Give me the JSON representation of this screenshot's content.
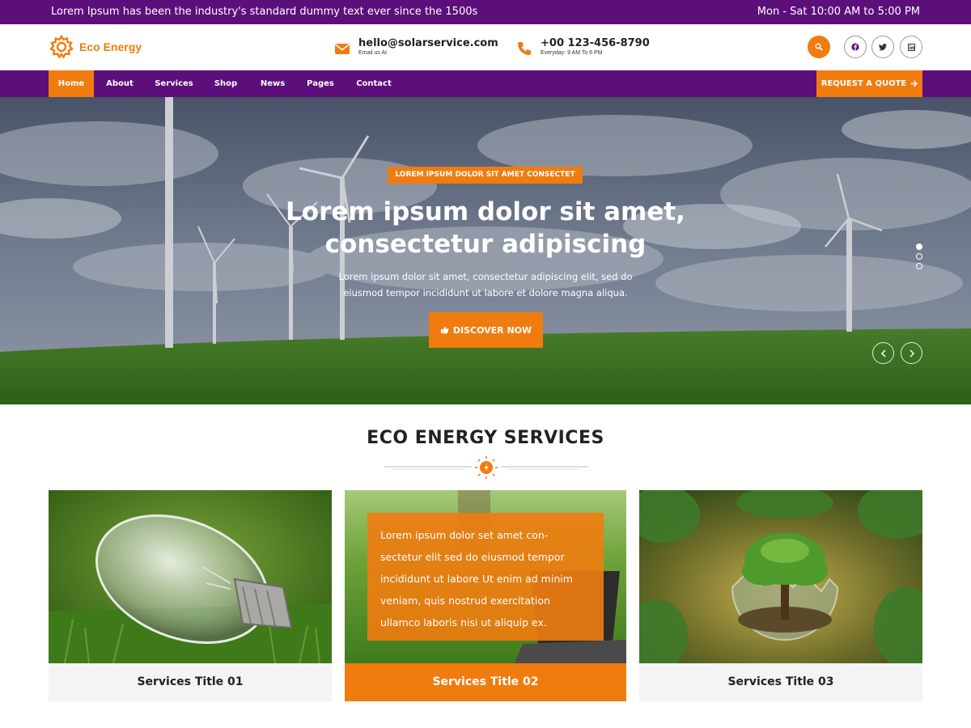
{
  "topbar": {
    "announcement": "Lorem Ipsum has been the industry's standard dummy text ever since the 1500s",
    "hours": "Mon - Sat 10:00 AM to 5:00 PM"
  },
  "header": {
    "logo_text": "Eco Energy",
    "email": "hello@solarservice.com",
    "email_sub": "Email us At",
    "phone": "+00 123-456-8790",
    "phone_sub": "Everyday: 9 AM To 6 PM"
  },
  "nav": {
    "items": [
      "Home",
      "About",
      "Services",
      "Shop",
      "News",
      "Pages",
      "Contact"
    ],
    "quote_label": "REQUEST A QUOTE"
  },
  "hero": {
    "badge": "LOREM IPSUM DOLOR SIT AMET CONSECTET",
    "title_line1": "Lorem ipsum dolor sit amet,",
    "title_line2": "consectetur adipiscing",
    "text_line1": "Lorem ipsum dolor sit amet, consectetur adipiscing elit, sed do",
    "text_line2": "eiusmod tempor incididunt ut labore et dolore magna aliqua.",
    "button_label": "DISCOVER NOW"
  },
  "services": {
    "heading": "ECO ENERGY SERVICES",
    "overlay_lines": [
      "Lorem ipsum dolor set amet con-",
      "sectetur elit sed do eiusmod tempor",
      "incididunt ut labore Ut enim ad minim",
      "veniam, quis nostrud exercitation",
      "ullamco laboris nisi ut aliquip ex."
    ],
    "cards": [
      {
        "title": "Services Title 01"
      },
      {
        "title": "Services Title 02"
      },
      {
        "title": "Services Title 03"
      }
    ]
  },
  "colors": {
    "brand_purple": "#5c0f7a",
    "accent_orange": "#f07c10"
  },
  "icons": [
    "sun-gear-logo-icon",
    "envelope-icon",
    "phone-icon",
    "search-icon",
    "facebook-icon",
    "twitter-icon",
    "linkedin-icon",
    "arrow-right-icon",
    "hand-point-icon",
    "chevron-left-icon",
    "chevron-right-icon",
    "sun-divider-icon"
  ]
}
